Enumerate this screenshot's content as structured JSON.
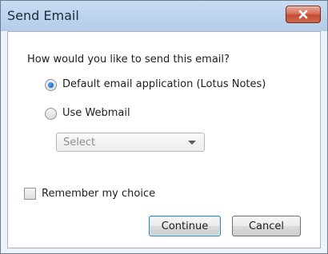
{
  "window": {
    "title": "Send Email"
  },
  "dialog": {
    "question": "How would you like to send this email?",
    "options": [
      {
        "label": "Default email application (Lotus Notes)",
        "selected": true
      },
      {
        "label": "Use Webmail",
        "selected": false
      }
    ],
    "webmail_select": {
      "value": "Select",
      "enabled": false
    },
    "remember": {
      "label": "Remember my choice",
      "checked": false
    },
    "buttons": {
      "continue_label": "Continue",
      "cancel_label": "Cancel"
    }
  },
  "icons": {
    "close": "close-icon",
    "dropdown": "chevron-down-icon"
  },
  "colors": {
    "titlebar": "#b9d1ea",
    "close_button": "#c75050",
    "radio_selected": "#1a64c8",
    "disabled_text": "#8c8c8c"
  }
}
